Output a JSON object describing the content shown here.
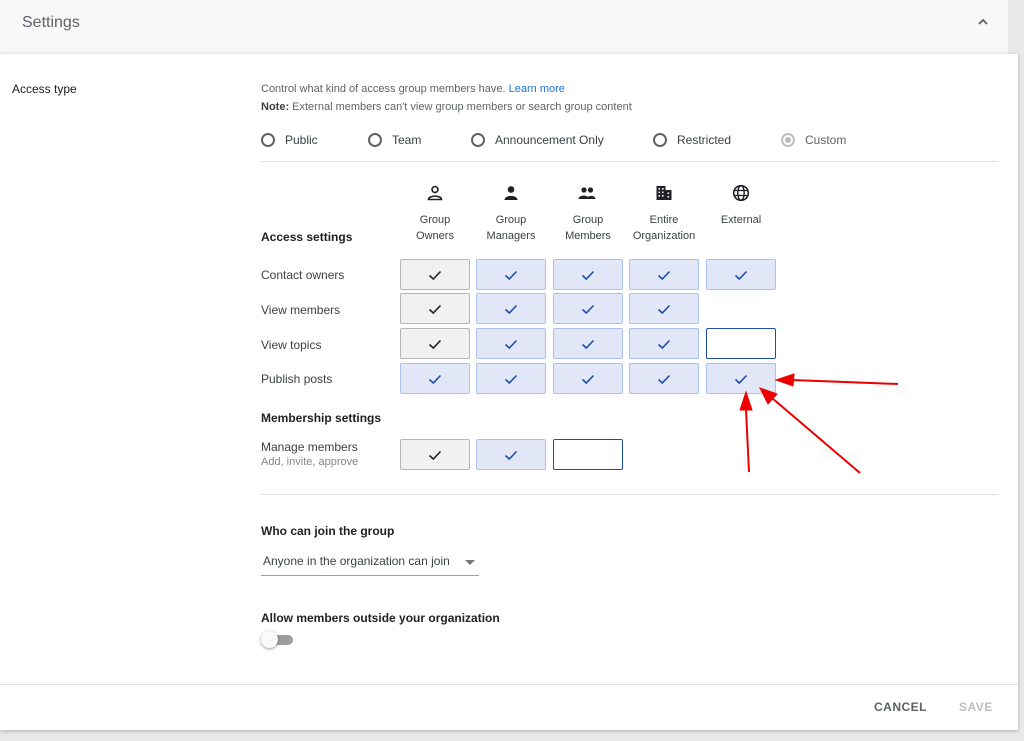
{
  "header": {
    "title": "Settings"
  },
  "access": {
    "section_label": "Access type",
    "description": "Control what kind of access group members have.",
    "learn_more": "Learn more",
    "note_prefix": "Note:",
    "note_text": " External members can't view group members or search group content",
    "options": [
      "Public",
      "Team",
      "Announcement Only",
      "Restricted",
      "Custom"
    ],
    "selected": "Custom"
  },
  "columns": [
    {
      "icon": "group-owner-icon",
      "label1": "Group",
      "label2": "Owners"
    },
    {
      "icon": "person-icon",
      "label1": "Group",
      "label2": "Managers"
    },
    {
      "icon": "people-icon",
      "label1": "Group",
      "label2": "Members"
    },
    {
      "icon": "building-icon",
      "label1": "Entire",
      "label2": "Organization"
    },
    {
      "icon": "globe-icon",
      "label1": "External",
      "label2": ""
    }
  ],
  "access_settings": {
    "heading": "Access settings",
    "rows": [
      {
        "label": "Contact owners",
        "cells": [
          "owner",
          "on",
          "on",
          "on",
          "on"
        ]
      },
      {
        "label": "View members",
        "cells": [
          "owner",
          "on",
          "on",
          "on",
          "none"
        ]
      },
      {
        "label": "View topics",
        "cells": [
          "owner",
          "on",
          "on",
          "on",
          "off"
        ]
      },
      {
        "label": "Publish posts",
        "cells": [
          "on",
          "on",
          "on",
          "on",
          "on"
        ]
      }
    ]
  },
  "membership_settings": {
    "heading": "Membership settings",
    "rows": [
      {
        "label": "Manage members",
        "sublabel": "Add, invite, approve",
        "cells": [
          "owner",
          "on",
          "off"
        ]
      }
    ]
  },
  "join": {
    "heading": "Who can join the group",
    "value": "Anyone in the organization can join"
  },
  "outside": {
    "heading": "Allow members outside your organization",
    "enabled": false
  },
  "footer": {
    "cancel": "CANCEL",
    "save": "SAVE"
  },
  "colors": {
    "checked_cell_bg": "#e2e7f8",
    "checked_cell_border": "#a9c0f0",
    "check_blue": "#1a4ea8",
    "owner_cell_bg": "#f1f1f1",
    "link_blue": "#1a73e8",
    "annotation_arrow": "#ee0000"
  }
}
